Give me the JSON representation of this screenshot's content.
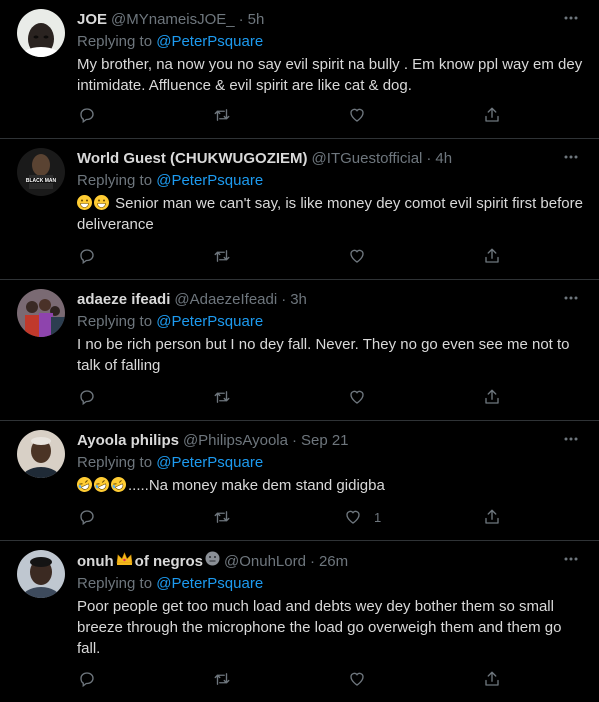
{
  "tweets": [
    {
      "name": "JOE",
      "handle": "@MYnameisJOE_",
      "time": "5h",
      "replying_label": "Replying to",
      "mention": "@PeterPsquare",
      "text": "My brother, na now you no say evil spirit na bully . Em know ppl way em dey intimidate.  Affluence & evil spirit are like cat & dog.",
      "likes": ""
    },
    {
      "name": "World Guest (CHUKWUGOZIEM)",
      "handle": "@ITGuestofficial",
      "time": "4h",
      "replying_label": "Replying to",
      "mention": "@PeterPsquare",
      "text": " Senior man we can't say, is like money dey comot evil spirit first before deliverance",
      "emoji_prefix": [
        "grinning-face-emoji",
        "grinning-face-emoji"
      ],
      "likes": ""
    },
    {
      "name": "adaeze ifeadi",
      "handle": "@AdaezeIfeadi",
      "time": "3h",
      "replying_label": "Replying to",
      "mention": "@PeterPsquare",
      "text": "I no be rich person but I no dey fall. Never. They no go even see me not to talk of falling",
      "likes": ""
    },
    {
      "name": "Ayoola philips",
      "handle": "@PhilipsAyoola",
      "time": "Sep 21",
      "replying_label": "Replying to",
      "mention": "@PeterPsquare",
      "text": ".....Na money make dem stand gidigba",
      "emoji_prefix": [
        "rofl-emoji",
        "rofl-emoji",
        "rofl-emoji"
      ],
      "likes": "1"
    },
    {
      "name": "onuh",
      "name_suffix": "of negros",
      "handle": "@OnuhLord",
      "time": "26m",
      "replying_label": "Replying to",
      "mention": "@PeterPsquare",
      "text": "Poor people get too much load and debts wey dey bother them so small breeze through the microphone the load go overweigh them and them go fall.",
      "likes": ""
    }
  ],
  "colors": {
    "background": "#000000",
    "text": "#d9d9d9",
    "secondary": "#6e767d",
    "link": "#1d9bf0",
    "divider": "#2f3336"
  },
  "icons": {
    "more": "more-dots-icon",
    "reply": "reply-icon",
    "retweet": "retweet-icon",
    "like": "like-heart-icon",
    "share": "share-icon"
  }
}
